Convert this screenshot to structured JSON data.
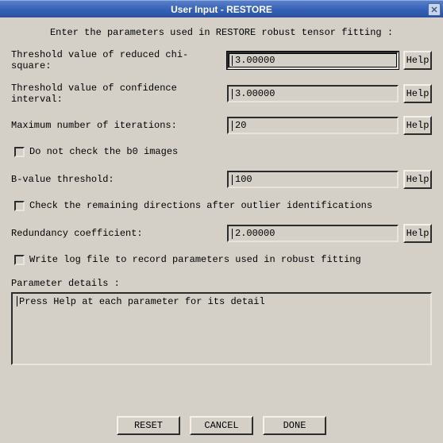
{
  "window": {
    "title": "User Input - RESTORE",
    "close_glyph": "✕"
  },
  "instruction": "Enter the parameters used in RESTORE robust tensor fitting :",
  "fields": {
    "chi_square": {
      "label": "Threshold value of reduced chi-square:",
      "value": "3.00000"
    },
    "confidence": {
      "label": "Threshold value of confidence interval:",
      "value": "3.00000"
    },
    "iterations": {
      "label": "Maximum number of iterations:",
      "value": "20"
    },
    "bvalue": {
      "label": "B-value threshold:",
      "value": "100"
    },
    "redundancy": {
      "label": "Redundancy coefficient:",
      "value": "2.00000"
    }
  },
  "checkboxes": {
    "no_b0": "Do not check the b0 images",
    "check_dirs": "Check the remaining directions after outlier identifications",
    "write_log": "Write log file to record parameters used in robust fitting"
  },
  "details": {
    "label": "Parameter details :",
    "text": "Press Help at each parameter for its detail"
  },
  "buttons": {
    "help": "Help",
    "reset": "RESET",
    "cancel": "CANCEL",
    "done": "DONE"
  }
}
